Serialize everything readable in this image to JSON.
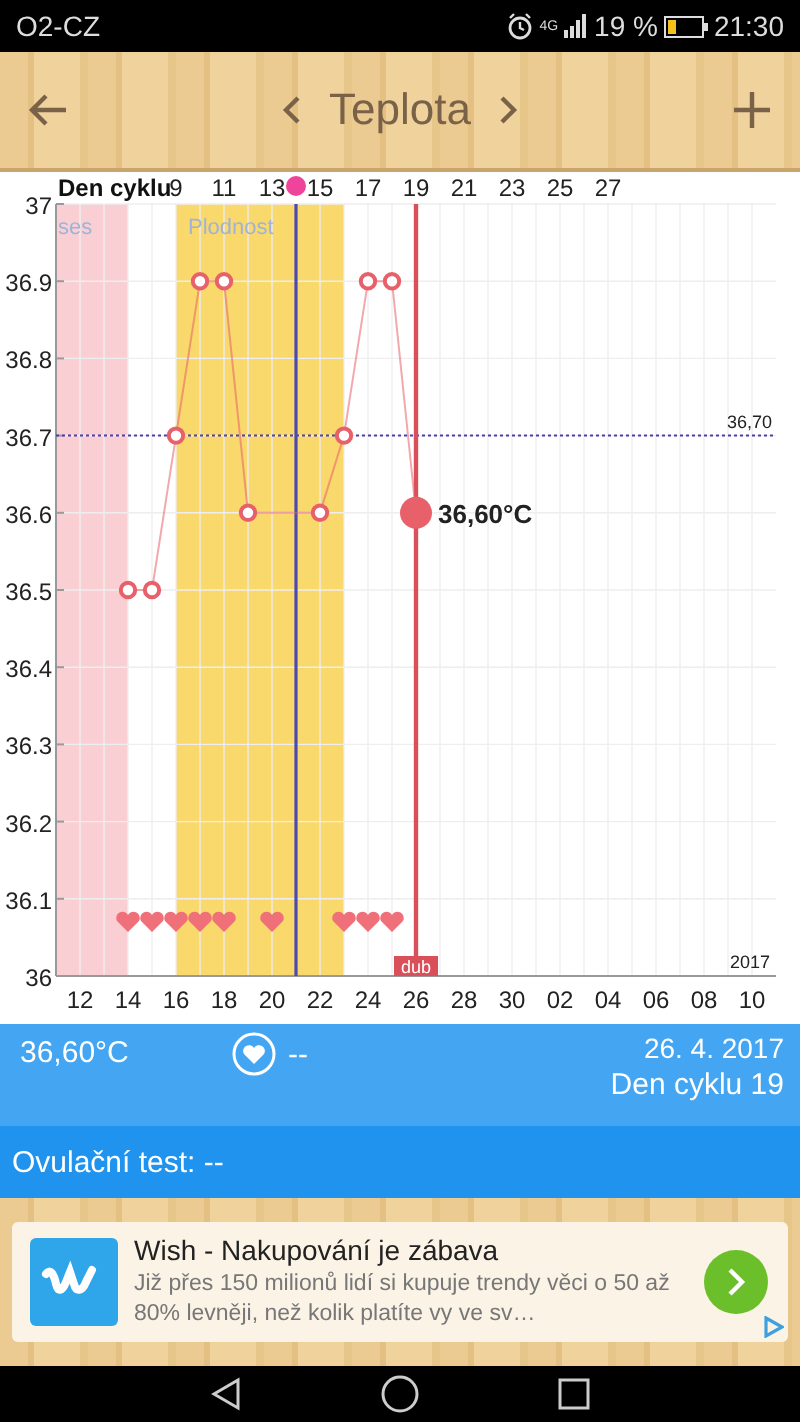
{
  "status_bar": {
    "carrier": "O2-CZ",
    "network": "4G",
    "battery": "19 %",
    "time": "21:30"
  },
  "header": {
    "title": "Teplota"
  },
  "chart": {
    "date_labels": [
      "12",
      "14",
      "16",
      "18",
      "20",
      "22",
      "24",
      "26",
      "28",
      "30",
      "02",
      "04",
      "06",
      "08",
      "10"
    ],
    "year": "2017",
    "chart_data": {
      "type": "line",
      "grid": true,
      "xlabel": "Den cyklu",
      "x": [
        7,
        8,
        9,
        10,
        11,
        12,
        13,
        15,
        16,
        17,
        18,
        19
      ],
      "series": [
        {
          "color": "#e8606a",
          "marker": "circle",
          "values": [
            36.5,
            36.5,
            36.7,
            36.9,
            36.9,
            36.6,
            null,
            36.6,
            36.7,
            36.9,
            36.9,
            36.6
          ]
        },
        {
          "type": "scatter",
          "color": "#f0707a",
          "values": [
            36.07,
            36.07,
            36.07,
            36.07,
            36.07,
            null,
            36.07,
            null,
            36.07,
            36.07,
            36.07,
            null
          ]
        }
      ],
      "xlim": [
        4,
        33
      ],
      "ylim": [
        36,
        37
      ],
      "yticks": [
        {
          "value": 36,
          "label": "36"
        },
        {
          "value": 36.1,
          "label": "36.1"
        },
        {
          "value": 36.2,
          "label": "36.2"
        },
        {
          "value": 36.3,
          "label": "36.3"
        },
        {
          "value": 36.4,
          "label": "36.4"
        },
        {
          "value": 36.5,
          "label": "36.5"
        },
        {
          "value": 36.6,
          "label": "36.6"
        },
        {
          "value": 36.7,
          "label": "36.7"
        },
        {
          "value": 36.8,
          "label": "36.8"
        },
        {
          "value": 36.9,
          "label": "36.9"
        },
        {
          "value": 37,
          "label": "37"
        }
      ],
      "xticks": [
        9,
        11,
        13,
        15,
        17,
        19,
        21,
        23,
        25,
        27
      ],
      "bands": [
        {
          "axis": "x",
          "from": 4,
          "to": 7,
          "color": "#f9cfd3",
          "label": "ses"
        },
        {
          "axis": "x",
          "from": 9,
          "to": 16,
          "color": "#f9d86c",
          "label": "Plodnost"
        }
      ],
      "ref_lines": [
        {
          "axis": "y",
          "value": 36.7,
          "color": "#4b3fa8",
          "label": "36,70"
        },
        {
          "axis": "x",
          "value": 14,
          "color": "#4a4ab0"
        },
        {
          "axis": "x",
          "value": 19,
          "color": "#d9505a"
        }
      ],
      "annotations": [
        {
          "x": 19,
          "y": 36.6,
          "text": "36,60°C"
        },
        {
          "x": 19,
          "y": 36,
          "text": "dub"
        }
      ]
    }
  },
  "info": {
    "temperature": "36,60°C",
    "intercourse": "--",
    "date": "26. 4. 2017",
    "cycle_day": "Den cyklu 19"
  },
  "ovulation": {
    "label": "Ovulační test: --"
  },
  "ad": {
    "title": "Wish - Nakupování je zábava",
    "text": "Již přes 150 milionů lidí si kupuje trendy věci o 50 až 80% levněji, než kolik platíte vy ve sv…"
  }
}
